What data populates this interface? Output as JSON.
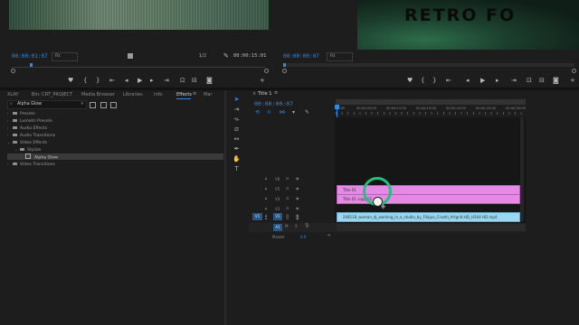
{
  "source_monitor": {
    "timecode": "00:00:01:07",
    "fit": "Fit",
    "fraction": "1/2",
    "duration": "00:00:15:01"
  },
  "program_monitor": {
    "timecode": "00:00:00:07",
    "fit": "Fit",
    "overlay_text": "RETRO FO"
  },
  "project_panel": {
    "tabs": [
      "XLAY",
      "Bin: CRT_PROJECT",
      "Media Browser",
      "Libraries",
      "Info",
      "Effects",
      "Mar"
    ],
    "active_tab": "Effects",
    "search_value": "Alpha Glow",
    "tree": [
      {
        "label": "Presets",
        "depth": 0
      },
      {
        "label": "Lumetri Presets",
        "depth": 0
      },
      {
        "label": "Audio Effects",
        "depth": 0
      },
      {
        "label": "Audio Transitions",
        "depth": 0
      },
      {
        "label": "Video Effects",
        "depth": 0
      },
      {
        "label": "Stylize",
        "depth": 1
      },
      {
        "label": "Alpha Glow",
        "depth": 2
      },
      {
        "label": "Video Transitions",
        "depth": 0
      }
    ]
  },
  "timeline": {
    "sequence_tab": "Title 1",
    "timecode": "00:00:00:07",
    "ruler_labels": [
      "00:00",
      "00:00:05:00",
      "00:00:10:00",
      "00:00:15:00",
      "00:00:20:00",
      "00:00:25:00",
      "00:00:30:00"
    ],
    "tracks": {
      "video": [
        "V6",
        "V5",
        "V4",
        "V3",
        "V2",
        "V1"
      ],
      "audio": [
        "A1"
      ],
      "source_v": "V1",
      "source_a": "A1",
      "master_label": "Master",
      "master_value": "0.0"
    },
    "clips": [
      {
        "label": "Title 01",
        "track": "V3",
        "color": "#e48ae4"
      },
      {
        "label": "Title 01 copy 01",
        "track": "V2",
        "color": "#e48ae4"
      },
      {
        "label": "208118_woman_dj_working_in_a_studio_by_Filippo_Cinotti_Artgrid-HD_H264-HD.mp4",
        "track": "V1",
        "color": "#9ad6f2"
      }
    ]
  },
  "colors": {
    "accent": "#2d8ceb",
    "title_clip": "#e48ae4",
    "video_clip": "#9ad6f2",
    "highlight_ring": "#1fc27a"
  }
}
